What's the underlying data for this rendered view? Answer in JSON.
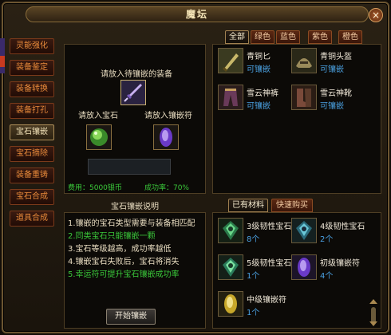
{
  "window": {
    "title": "魔坛",
    "close_label": "×"
  },
  "sidebar": {
    "items": [
      {
        "label": "灵能强化",
        "active": false
      },
      {
        "label": "装备鉴定",
        "active": false
      },
      {
        "label": "装备转换",
        "active": false
      },
      {
        "label": "装备打孔",
        "active": false
      },
      {
        "label": "宝石镶嵌",
        "active": true
      },
      {
        "label": "宝石摘除",
        "active": false
      },
      {
        "label": "装备重铸",
        "active": false
      },
      {
        "label": "宝石合成",
        "active": false
      },
      {
        "label": "道具合成",
        "active": false
      }
    ]
  },
  "inlay": {
    "equip_prompt": "请放入待镶嵌的装备",
    "gem_prompt": "请放入宝石",
    "charm_prompt": "请放入镶嵌符",
    "fee": "费用：5000银币",
    "rate": "成功率：70%"
  },
  "description": {
    "title": "宝石镶嵌说明",
    "lines": [
      {
        "text": "1.镶嵌的宝石类型需要与装备相匹配",
        "color": "#f0e8d8"
      },
      {
        "text": "2.同类宝石只能镶嵌一颗",
        "color": "#3ac83a"
      },
      {
        "text": "3.宝石等级越高，成功率越低",
        "color": "#f0e8d8"
      },
      {
        "text": "4.镶嵌宝石失败后，宝石将消失",
        "color": "#f0e8d8"
      },
      {
        "text": "5.幸运符可提升宝石镶嵌成功率",
        "color": "#3ac83a"
      }
    ],
    "start_label": "开始镶嵌"
  },
  "equip_tabs": [
    {
      "label": "全部",
      "active": true
    },
    {
      "label": "绿色",
      "active": false
    },
    {
      "label": "蓝色",
      "active": false
    },
    {
      "label": "紫色",
      "active": false
    },
    {
      "label": "橙色",
      "active": false
    }
  ],
  "equipment": [
    {
      "name": "青铜匕",
      "sub": "可镶嵌",
      "icon": "dagger-icon"
    },
    {
      "name": "青铜头盔",
      "sub": "可镶嵌",
      "icon": "helmet-icon"
    },
    {
      "name": "雪云神裤",
      "sub": "可镶嵌",
      "icon": "pants-icon"
    },
    {
      "name": "雪云神靴",
      "sub": "可镶嵌",
      "icon": "boots-icon"
    }
  ],
  "material_tabs": [
    {
      "label": "已有材料",
      "active": true
    },
    {
      "label": "快速购买",
      "active": false
    }
  ],
  "materials": [
    {
      "name": "3级韧性宝石",
      "sub": "8个",
      "icon": "green-gem-icon"
    },
    {
      "name": "4级韧性宝石",
      "sub": "2个",
      "icon": "green-gem-icon"
    },
    {
      "name": "5级韧性宝石",
      "sub": "1个",
      "icon": "green-gem-icon"
    },
    {
      "name": "初级镶嵌符",
      "sub": "4个",
      "icon": "purple-charm-icon"
    },
    {
      "name": "中级镶嵌符",
      "sub": "1个",
      "icon": "yellow-charm-icon"
    }
  ],
  "colors": {
    "accent_orange": "#e88a3a",
    "success_green": "#3ac83a",
    "count_blue": "#4aa0e0",
    "frame_gold": "#8a6c3a"
  }
}
